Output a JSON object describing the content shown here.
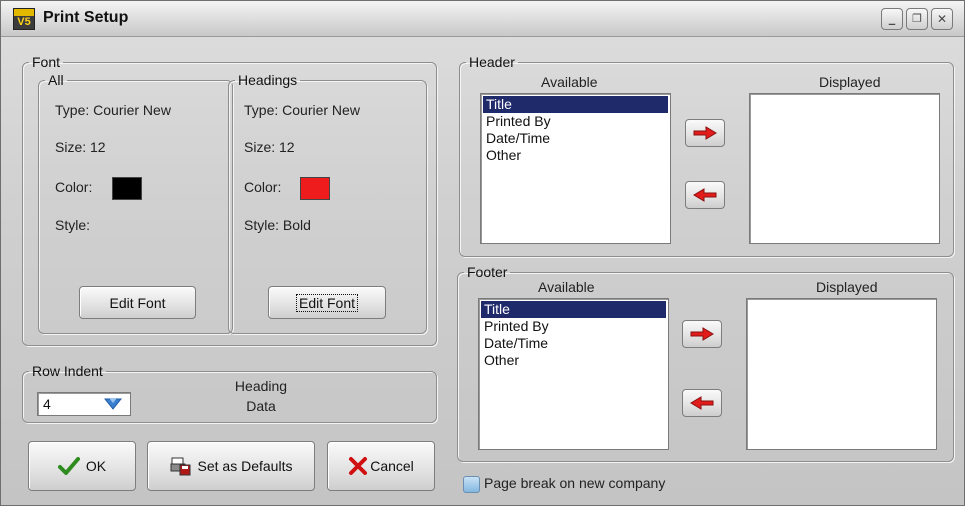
{
  "window": {
    "title": "Print Setup",
    "icon_text": "V5",
    "controls": {
      "minimize": "_",
      "restore": "❐",
      "close": "✕"
    }
  },
  "font": {
    "legend": "Font",
    "all": {
      "legend": "All",
      "type": "Type:  Courier New",
      "size": "Size:  12",
      "color_label": "Color:",
      "color": "#000000",
      "style": "Style:",
      "button": "Edit Font"
    },
    "headings": {
      "legend": "Headings",
      "type": "Type:  Courier New",
      "size": "Size:  12",
      "color_label": "Color:",
      "color": "#ee1c1c",
      "style": "Style:  Bold",
      "button": "Edit Font"
    }
  },
  "row_indent": {
    "legend": "Row Indent",
    "value": "4",
    "heading": "Heading",
    "data": "Data"
  },
  "buttons": {
    "ok": "OK",
    "defaults": "Set as Defaults",
    "cancel": "Cancel"
  },
  "header": {
    "legend": "Header",
    "available_label": "Available",
    "displayed_label": "Displayed",
    "available": [
      "Title",
      "Printed By",
      "Date/Time",
      "Other"
    ],
    "selected": "Title"
  },
  "footer": {
    "legend": "Footer",
    "available_label": "Available",
    "displayed_label": "Displayed",
    "available": [
      "Title",
      "Printed By",
      "Date/Time",
      "Other"
    ],
    "selected": "Title"
  },
  "page_break": {
    "label": "Page break on new company",
    "checked": false
  },
  "colors": {
    "selection": "#1f2a6b",
    "arrow": "#e21b1b",
    "ok_check": "#2e8b1e",
    "cancel_x": "#d01010",
    "dropdown_arrow": "#3a7fd0"
  },
  "icons": {
    "ok": "check-icon",
    "defaults": "printer-disk-icon",
    "cancel": "x-icon",
    "move_right": "arrow-right-icon",
    "move_left": "arrow-left-icon"
  }
}
